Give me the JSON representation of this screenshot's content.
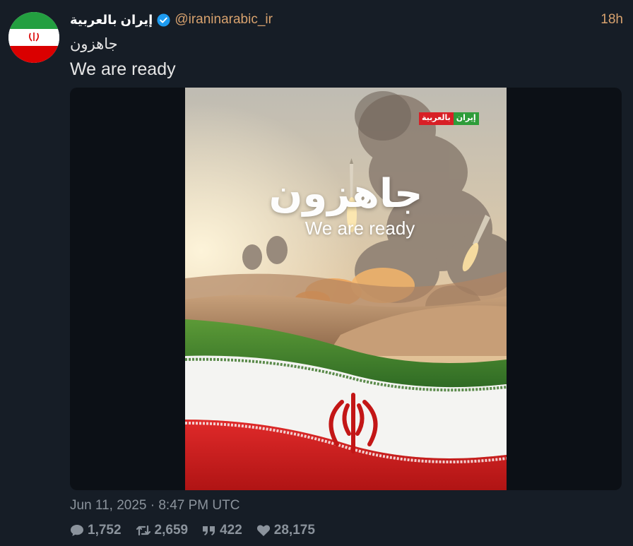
{
  "tweet": {
    "display_name": "إيران بالعربية",
    "handle": "@iraninarabic_ir",
    "time_ago": "18h",
    "text_ar": "جاهزون",
    "text_en": "We are ready",
    "date": "Jun 11, 2025 · 8:47 PM UTC"
  },
  "media": {
    "poster_title_ar": "جاهزون",
    "poster_title_en": "We are ready",
    "logo_ar_green": "إيران",
    "logo_ar_red": "بالعربية"
  },
  "stats": {
    "replies": "1,752",
    "retweets": "2,659",
    "quotes": "422",
    "likes": "28,175"
  },
  "icons": {
    "verified": "verified-badge-icon",
    "reply": "comment-icon",
    "retweet": "retweet-icon",
    "quote": "quote-icon",
    "like": "heart-icon"
  },
  "colors": {
    "background": "#161d26",
    "handle": "#d8a26e",
    "muted": "#8b939c",
    "verified": "#1d9bf0"
  }
}
